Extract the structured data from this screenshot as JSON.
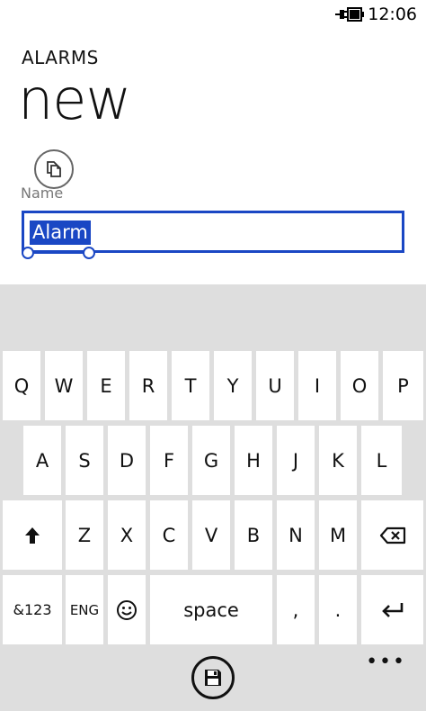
{
  "status": {
    "time": "12:06",
    "battery_icon": "battery-charging-icon"
  },
  "header": {
    "app_title": "ALARMS",
    "page_title": "new"
  },
  "form": {
    "name_label": "Name",
    "name_value": "Alarm",
    "copy_icon": "copy-icon"
  },
  "keyboard": {
    "row1": [
      "Q",
      "W",
      "E",
      "R",
      "T",
      "Y",
      "U",
      "I",
      "O",
      "P"
    ],
    "row2": [
      "A",
      "S",
      "D",
      "F",
      "G",
      "H",
      "J",
      "K",
      "L"
    ],
    "row3": [
      "Z",
      "X",
      "C",
      "V",
      "B",
      "N",
      "M"
    ],
    "shift_glyph": "🡑",
    "backspace_icon": "backspace-icon",
    "symbols_label": "&123",
    "lang_label": "ENG",
    "emoji_glyph": "☺",
    "space_label": "space",
    "comma_label": ",",
    "period_label": ".",
    "enter_icon": "enter-icon"
  },
  "appbar": {
    "save_icon": "save-icon",
    "more_label": "•••"
  },
  "colors": {
    "accent": "#1a47c4",
    "keyboard_bg": "#dedede",
    "key_bg": "#ffffff"
  }
}
